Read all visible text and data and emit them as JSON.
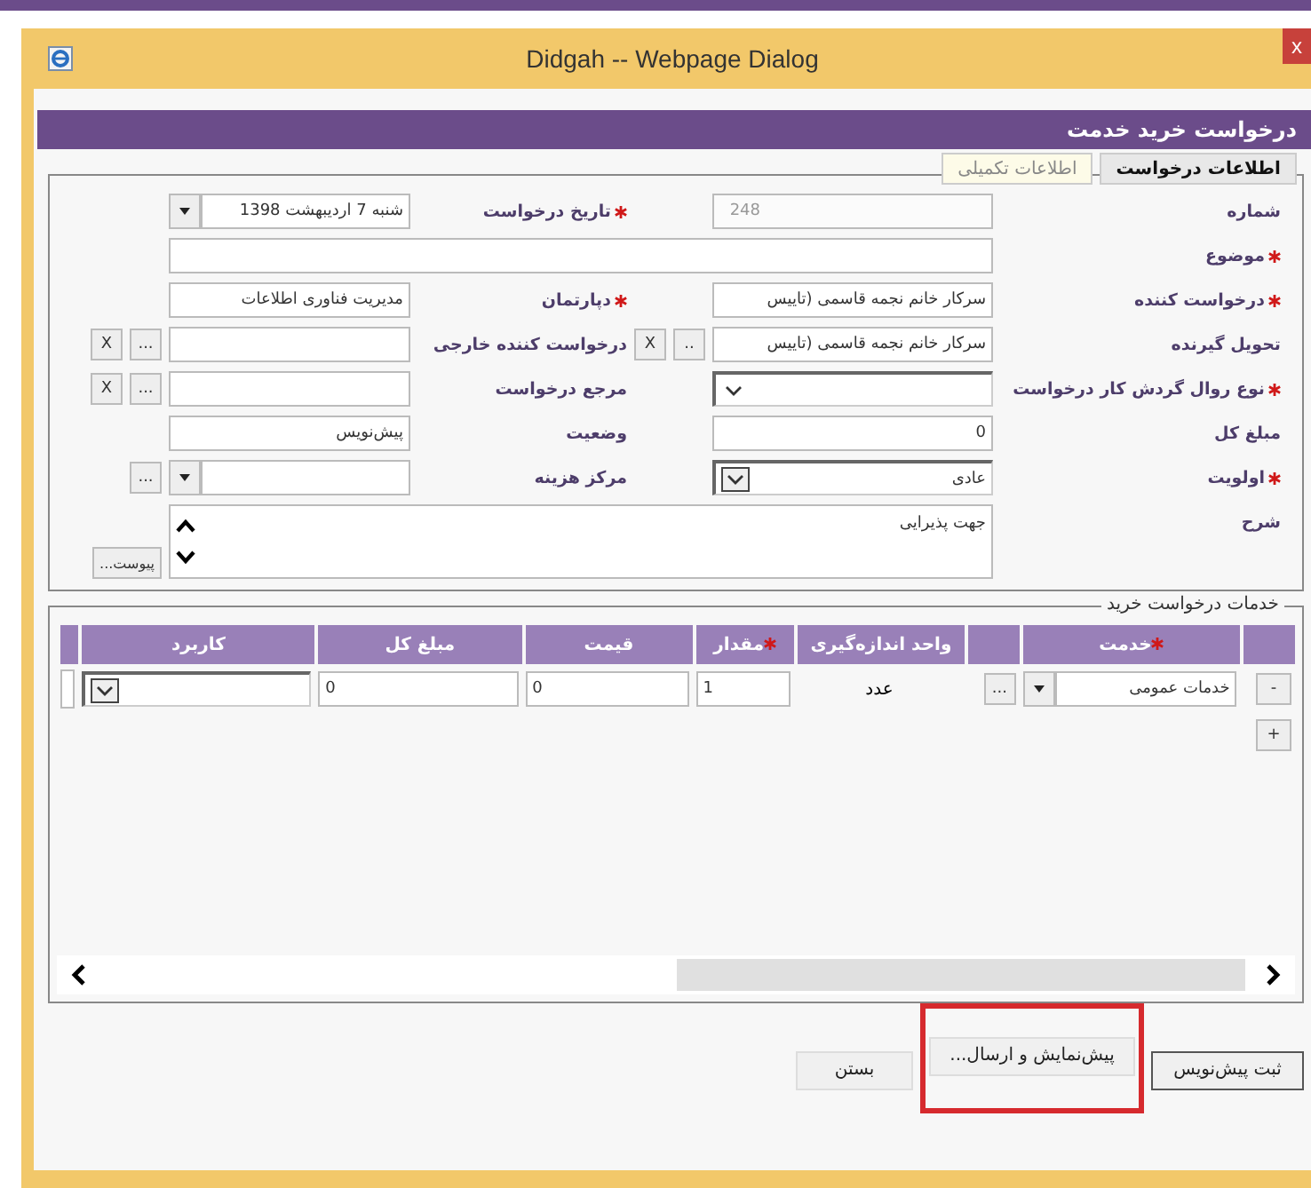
{
  "window": {
    "title": "Didgah -- Webpage Dialog",
    "close": "x"
  },
  "heading": "درخواست خرید خدمت",
  "tabs": [
    {
      "label": "اطلاعات درخواست",
      "selected": true
    },
    {
      "label": "اطلاعات تکمیلی",
      "selected": false
    }
  ],
  "fields": [
    {
      "label": "شماره",
      "required": false,
      "kind": "text",
      "value": "248",
      "disabled": true
    },
    {
      "label": "تاریخ درخواست",
      "required": true,
      "kind": "date",
      "value": "شنبه 7 اردیبهشت 1398"
    },
    {
      "label": "موضوع",
      "required": true,
      "kind": "wide"
    },
    {
      "label": "درخواست کننده",
      "required": true,
      "kind": "text",
      "value": "سرکار خانم نجمه قاسمی (تاییس"
    },
    {
      "label": "دپارتمان",
      "required": true,
      "kind": "text",
      "value": "مدیریت فناوری اطلاعات"
    },
    {
      "label": "تحویل گیرنده",
      "required": false,
      "kind": "text",
      "value": "سرکار خانم نجمه قاسمی (تاییس",
      "buttons": [
        "..",
        "X"
      ]
    },
    {
      "label": "درخواست کننده خارجی",
      "required": false,
      "kind": "text",
      "buttons": [
        "...",
        "X"
      ]
    },
    {
      "label": "نوع روال گردش کار درخواست",
      "required": true,
      "kind": "select"
    },
    {
      "label": "مرجع درخواست",
      "required": false,
      "kind": "text",
      "buttons": [
        "...",
        "X"
      ]
    },
    {
      "label": "مبلغ کل",
      "required": false,
      "kind": "text",
      "value": "0"
    },
    {
      "label": "وضعیت",
      "required": false,
      "kind": "text",
      "value": "پیش‌نویس"
    },
    {
      "label": "اولویت",
      "required": true,
      "kind": "select",
      "value": "عادی"
    },
    {
      "label": "مرکز هزینه",
      "required": false,
      "kind": "combo",
      "buttons": [
        "..."
      ]
    },
    {
      "label": "شرح",
      "required": false,
      "kind": "textarea",
      "value": "جهت پذیرایی",
      "buttons": [
        "پیوست..."
      ]
    }
  ],
  "services": {
    "legend": "خدمات درخواست خرید",
    "columns": [
      {
        "label": "خدمت",
        "required": true
      },
      {
        "label": "واحد اندازه‌گیری",
        "required": false
      },
      {
        "label": "مقدار",
        "required": true
      },
      {
        "label": "قیمت",
        "required": false
      },
      {
        "label": "مبلغ کل",
        "required": false
      },
      {
        "label": "کاربرد",
        "required": false
      }
    ],
    "rows": [
      {
        "remove": "-",
        "service": "خدمات عمومی",
        "browse": "...",
        "unit": "عدد",
        "quantity": "1",
        "price": "0",
        "total": "0"
      }
    ],
    "add": "+"
  },
  "buttons": [
    {
      "label": "ثبت پیش‌نویس",
      "highlighted": false
    },
    {
      "label": "پیش‌نمایش و ارسال...",
      "highlighted": true
    },
    {
      "label": "بستن",
      "highlighted": false
    }
  ]
}
